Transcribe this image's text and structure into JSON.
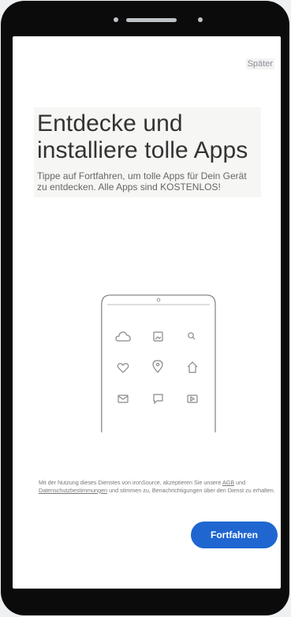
{
  "header": {
    "later_label": "Später"
  },
  "hero": {
    "title_line1": "Entdecke und",
    "title_line2": "installiere tolle Apps",
    "description": "Tippe auf Fortfahren, um tolle Apps für Dein Gerät zu entdecken. Alle Apps sind KOSTENLOS!"
  },
  "illustration": {
    "icons": [
      "cloud-icon",
      "image-icon",
      "search-icon",
      "heart-icon",
      "location-pin-icon",
      "home-icon",
      "mail-icon",
      "chat-bubble-icon",
      "video-icon"
    ]
  },
  "terms": {
    "part1": "Mit der Nutzung dieses Dienstes von ironSource, akzeptieren Sie unsere",
    "agb_link": "AGB",
    "and": "und",
    "privacy_link": "Datenschutzbestimmungen",
    "part2": "und stimmen zu, Benachrichtigungen über den Dienst zu erhalten."
  },
  "actions": {
    "continue_label": "Fortfahren"
  },
  "colors": {
    "accent": "#1f66d1",
    "phone_frame": "#0b0b0c"
  }
}
